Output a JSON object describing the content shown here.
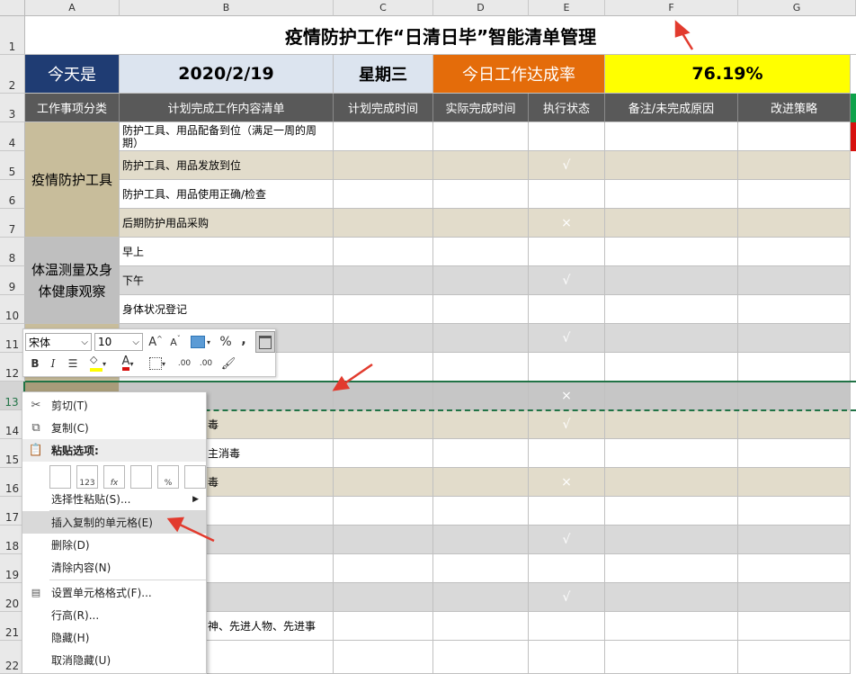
{
  "columns": [
    "A",
    "B",
    "C",
    "D",
    "E",
    "F",
    "G"
  ],
  "rows": [
    "1",
    "2",
    "3",
    "4",
    "5",
    "6",
    "7",
    "8",
    "9",
    "10",
    "11",
    "12",
    "13",
    "14",
    "15",
    "16",
    "17",
    "18",
    "19",
    "20",
    "21",
    "22"
  ],
  "title": "疫情防护工作“日清日毕”智能清单管理",
  "today": {
    "label": "今天是",
    "date": "2020/2/19",
    "weekday": "星期三",
    "rate_label": "今日工作达成率",
    "rate_value": "76.19%"
  },
  "headers": [
    "工作事项分类",
    "计划完成工作内容清单",
    "计划完成时间",
    "实际完成时间",
    "执行状态",
    "备注/未完成原因",
    "改进策略"
  ],
  "categories": {
    "epidemic_tools": "疫情防护工具",
    "health_check": "体温测量及身体健康观察"
  },
  "items": {
    "r4": "防护工具、用品配备到位（满足一周的周期）",
    "r5": "防护工具、用品发放到位",
    "r6": "防护工具、用品使用正确/检查",
    "r7": "后期防护用品采购",
    "r8": "早上",
    "r9": "下午",
    "r10": "身体状况登记",
    "r14": "毒",
    "r15": "主消毒",
    "r16": "毒",
    "r21": "神、先进人物、先进事"
  },
  "status": {
    "ok": "√",
    "bad": "×",
    "rows": [
      "ok",
      "ok",
      "ok",
      "bad",
      "ok",
      "ok",
      "ok",
      "ok",
      "bad",
      "bad",
      "ok",
      "ok",
      "bad",
      "ok",
      "ok",
      "ok",
      "ok",
      "ok",
      "bad"
    ]
  },
  "mini_toolbar": {
    "font_name": "宋体",
    "font_size": "10",
    "grow_font": "A",
    "shrink_font": "A",
    "percent": "%",
    "comma": ",",
    "bold": "B",
    "italic": "I",
    "font_color": "A",
    "inc_decimal": ".00",
    "dec_decimal": ".00"
  },
  "context_menu": {
    "cut": "剪切(T)",
    "copy": "复制(C)",
    "paste_options": "粘贴选项:",
    "paste_icons": [
      "",
      "123",
      "fx",
      "",
      "%",
      ""
    ],
    "paste_special": "选择性粘贴(S)...",
    "insert_copied": "插入复制的单元格(E)",
    "delete": "删除(D)",
    "clear": "清除内容(N)",
    "format_cells": "设置单元格格式(F)...",
    "row_height": "行高(R)...",
    "hide": "隐藏(H)",
    "unhide": "取消隐藏(U)"
  },
  "colors": {
    "navy": "#1f3c73",
    "orange": "#e46c0a",
    "yellow": "#ffff00",
    "green": "#0fa34b",
    "red": "#d7110e",
    "tan": "#c8bd9b",
    "beige": "#e2dccb",
    "gray": "#d9d9d9",
    "arrow": "#e23b2e"
  }
}
